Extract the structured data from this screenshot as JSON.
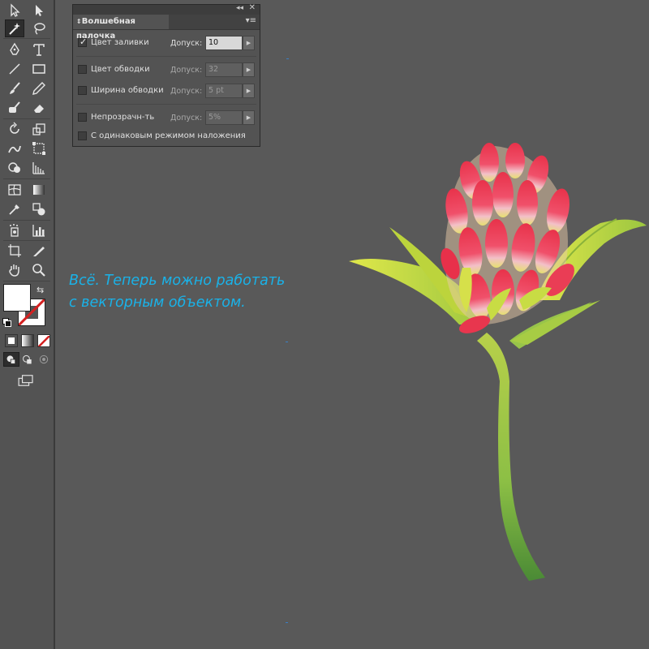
{
  "panel": {
    "title": "Волшебная палочка",
    "rows": [
      {
        "label": "Цвет заливки",
        "checked": true,
        "tolerance_label": "Допуск:",
        "value": "10"
      },
      {
        "label": "Цвет обводки",
        "checked": false,
        "tolerance_label": "Допуск:",
        "value": "32"
      },
      {
        "label": "Ширина обводки",
        "checked": false,
        "tolerance_label": "Допуск:",
        "value": "5 pt"
      },
      {
        "label": "Непрозрачн-ть",
        "checked": false,
        "tolerance_label": "Допуск:",
        "value": "5%"
      },
      {
        "label": "С одинаковым режимом наложения",
        "checked": false
      }
    ]
  },
  "annotation": {
    "line1": "Всё. Теперь можно работать",
    "line2": "с векторным объектом."
  },
  "tools": [
    "selection-tool",
    "direct-selection-tool",
    "magic-wand-tool",
    "lasso-tool",
    "pen-tool",
    "type-tool",
    "line-tool",
    "rectangle-tool",
    "paintbrush-tool",
    "pencil-tool",
    "blob-brush-tool",
    "eraser-tool",
    "rotate-tool",
    "scale-tool",
    "warp-tool",
    "free-transform-tool",
    "shape-builder-tool",
    "perspective-grid-tool",
    "mesh-tool",
    "gradient-tool",
    "eyedropper-tool",
    "blend-tool",
    "symbol-sprayer-tool",
    "column-graph-tool",
    "artboard-tool",
    "slice-tool",
    "hand-tool",
    "zoom-tool"
  ],
  "colors": {
    "annotation": "#1ab2e8",
    "canvas": "#595959",
    "fill_swatch": "#ffffff",
    "stroke_none": "#d42020"
  }
}
